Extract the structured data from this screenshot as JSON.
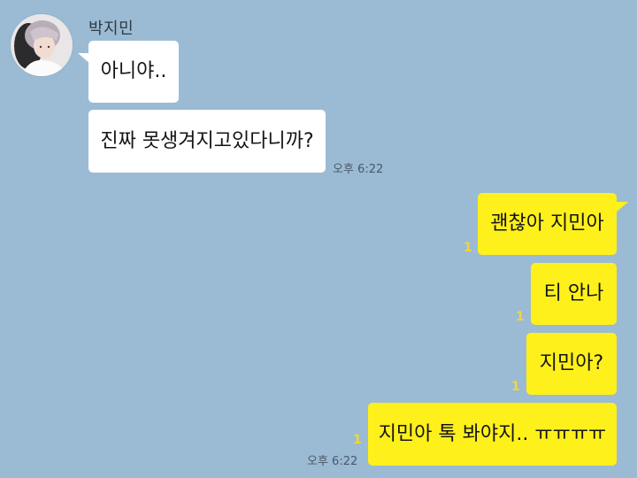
{
  "chat": {
    "sender": {
      "name": "박지민",
      "avatar_icon": "profile-photo"
    },
    "incoming": [
      {
        "text": "아니야.."
      },
      {
        "text": "진짜 못생겨지고있다니까?"
      }
    ],
    "incoming_time": "오후 6:22",
    "outgoing": [
      {
        "text": "괜찮아 지민아",
        "unread": "1"
      },
      {
        "text": "티 안나",
        "unread": "1"
      },
      {
        "text": "지민아?",
        "unread": "1"
      },
      {
        "text": "지민아 톡 봐야지.. ㅠㅠㅠㅠ",
        "unread": "1"
      }
    ],
    "outgoing_time": "오후 6:22"
  },
  "colors": {
    "background": "#9bbbd4",
    "incoming_bubble": "#ffffff",
    "outgoing_bubble": "#fef01b",
    "unread_count": "#f5d531"
  }
}
